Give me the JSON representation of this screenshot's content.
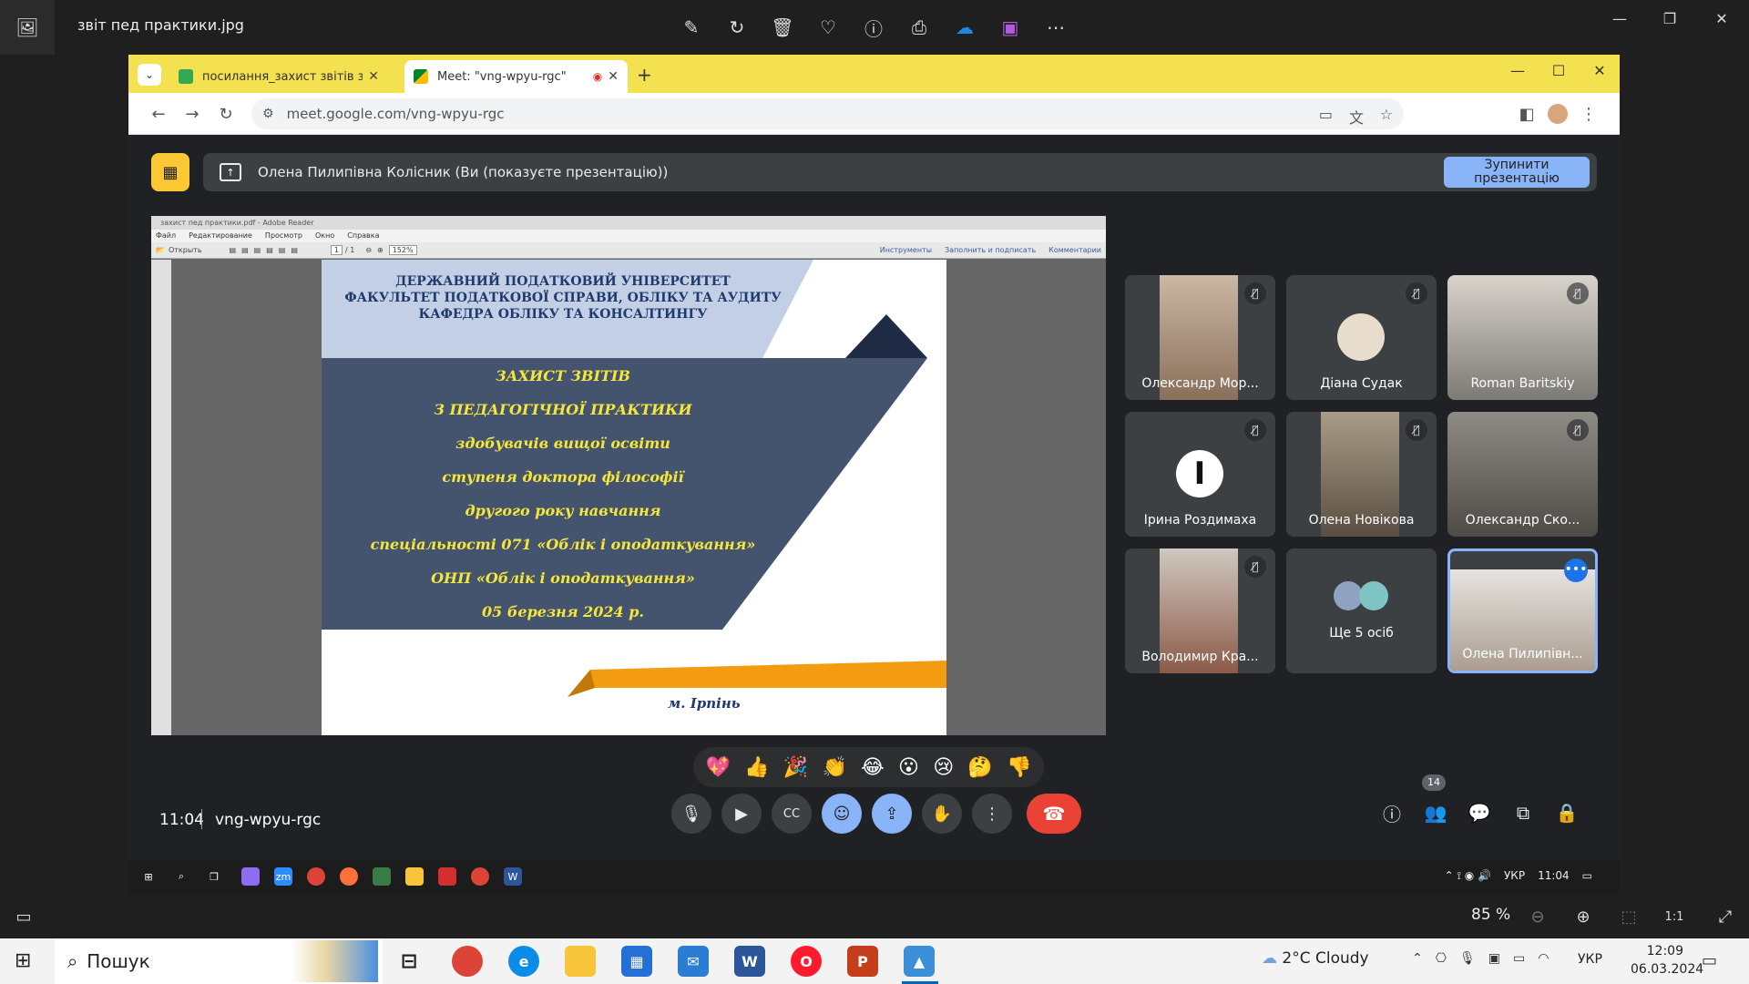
{
  "viewer": {
    "title": "звіт пед практики.jpg",
    "zoom": "85 %"
  },
  "browser": {
    "tabs": [
      {
        "label": "посилання_захист звітів з пра",
        "close": "✕"
      },
      {
        "label": "Meet: \"vng-wpyu-rgc\"",
        "close": "✕"
      }
    ],
    "url": "meet.google.com/vng-wpyu-rgc"
  },
  "meet": {
    "presenting_text": "Олена Пилипівна Колісник (Ви (показуєте презентацію))",
    "stop_button": "Зупинити презентацію",
    "time": "11:04",
    "code": "vng-wpyu-rgc",
    "participant_count": "14",
    "participants": [
      {
        "name": "Олександр Мор...",
        "muted": true
      },
      {
        "name": "Діана Судак",
        "muted": true
      },
      {
        "name": "Roman Baritskiy",
        "muted": true
      },
      {
        "name": "Ірина Роздимаха",
        "muted": true
      },
      {
        "name": "Олена Новікова",
        "muted": true
      },
      {
        "name": "Олександр Ско...",
        "muted": true
      },
      {
        "name": "Володимир Кра...",
        "muted": true
      },
      {
        "name": "Ще 5 осіб",
        "muted": false
      },
      {
        "name": "Олена Пилипівн...",
        "muted": false
      }
    ],
    "reactions": [
      "💖",
      "👍",
      "🎉",
      "👏",
      "😂",
      "😮",
      "😢",
      "🤔",
      "👎"
    ]
  },
  "reader": {
    "title": "захист пед практики.pdf - Adobe Reader",
    "menu": [
      "Файл",
      "Редактирование",
      "Просмотр",
      "Окно",
      "Справка"
    ],
    "open_label": "Открыть",
    "page": "1",
    "page_total": "/ 1",
    "zoom": "152%",
    "right_tools": [
      "Инструменты",
      "Заполнить и подписать",
      "Комментарии"
    ]
  },
  "slide": {
    "header": [
      "ДЕРЖАВНИЙ ПОДАТКОВИЙ УНІВЕРСИТЕТ",
      "ФАКУЛЬТЕТ ПОДАТКОВОЇ СПРАВИ, ОБЛІКУ ТА АУДИТУ",
      "КАФЕДРА ОБЛІКУ ТА КОНСАЛТИНГУ"
    ],
    "body": [
      "ЗАХИСТ ЗВІТІВ",
      "З ПЕДАГОГІЧНОЇ ПРАКТИКИ",
      "здобувачів вищої освіти",
      "ступеня доктора філософії",
      "другого року навчання",
      "спеціальності 071 «Облік і оподаткування»",
      "ОНП «Облік і оподаткування»",
      "05 березня 2024 р."
    ],
    "city": "м. Ірпінь"
  },
  "inner_taskbar": {
    "lang": "УКР",
    "time": "11:04"
  },
  "taskbar": {
    "search": "Пошук",
    "weather": "2°C  Cloudy",
    "lang": "УКР",
    "time": "12:09",
    "date": "06.03.2024"
  },
  "colors": {
    "tabstrip": "#f4e14f",
    "meet_bg": "#202124",
    "accent_blue": "#8ab4f8",
    "end_call": "#ea4335",
    "slide_navy": "#44546f",
    "slide_light": "#c3cfe4",
    "slide_orange": "#f39c12"
  }
}
